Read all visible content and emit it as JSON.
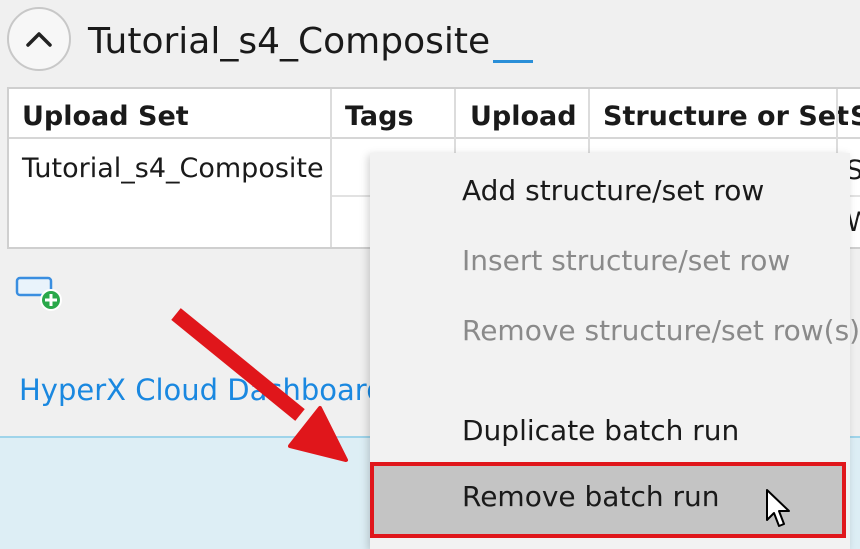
{
  "header": {
    "title": "Tutorial_s4_Composite"
  },
  "grid": {
    "columns": [
      "Upload Set",
      "Tags",
      "Upload",
      "Structure or Set",
      "S"
    ],
    "rows": [
      {
        "upload_set": "Tutorial_s4_Composite",
        "tags": "",
        "structures": [
          "S",
          "W"
        ]
      }
    ]
  },
  "links": {
    "dashboard": "HyperX Cloud Dashboard"
  },
  "context_menu": {
    "items": [
      {
        "label": "Add structure/set row",
        "enabled": true
      },
      {
        "label": "Insert structure/set row",
        "enabled": false
      },
      {
        "label": "Remove structure/set row(s)",
        "enabled": false
      },
      {
        "label": "Duplicate batch run",
        "enabled": true
      },
      {
        "label": "Remove batch run",
        "enabled": true,
        "hovered": true
      }
    ]
  },
  "colors": {
    "link": "#1a88e0",
    "highlight_border": "#e0161b",
    "annotation_arrow": "#e0161b",
    "band": "#ddeef5"
  },
  "icons": {
    "collapse": "chevron-up-icon",
    "add_row": "add-row-icon",
    "cursor": "mouse-pointer-icon"
  }
}
